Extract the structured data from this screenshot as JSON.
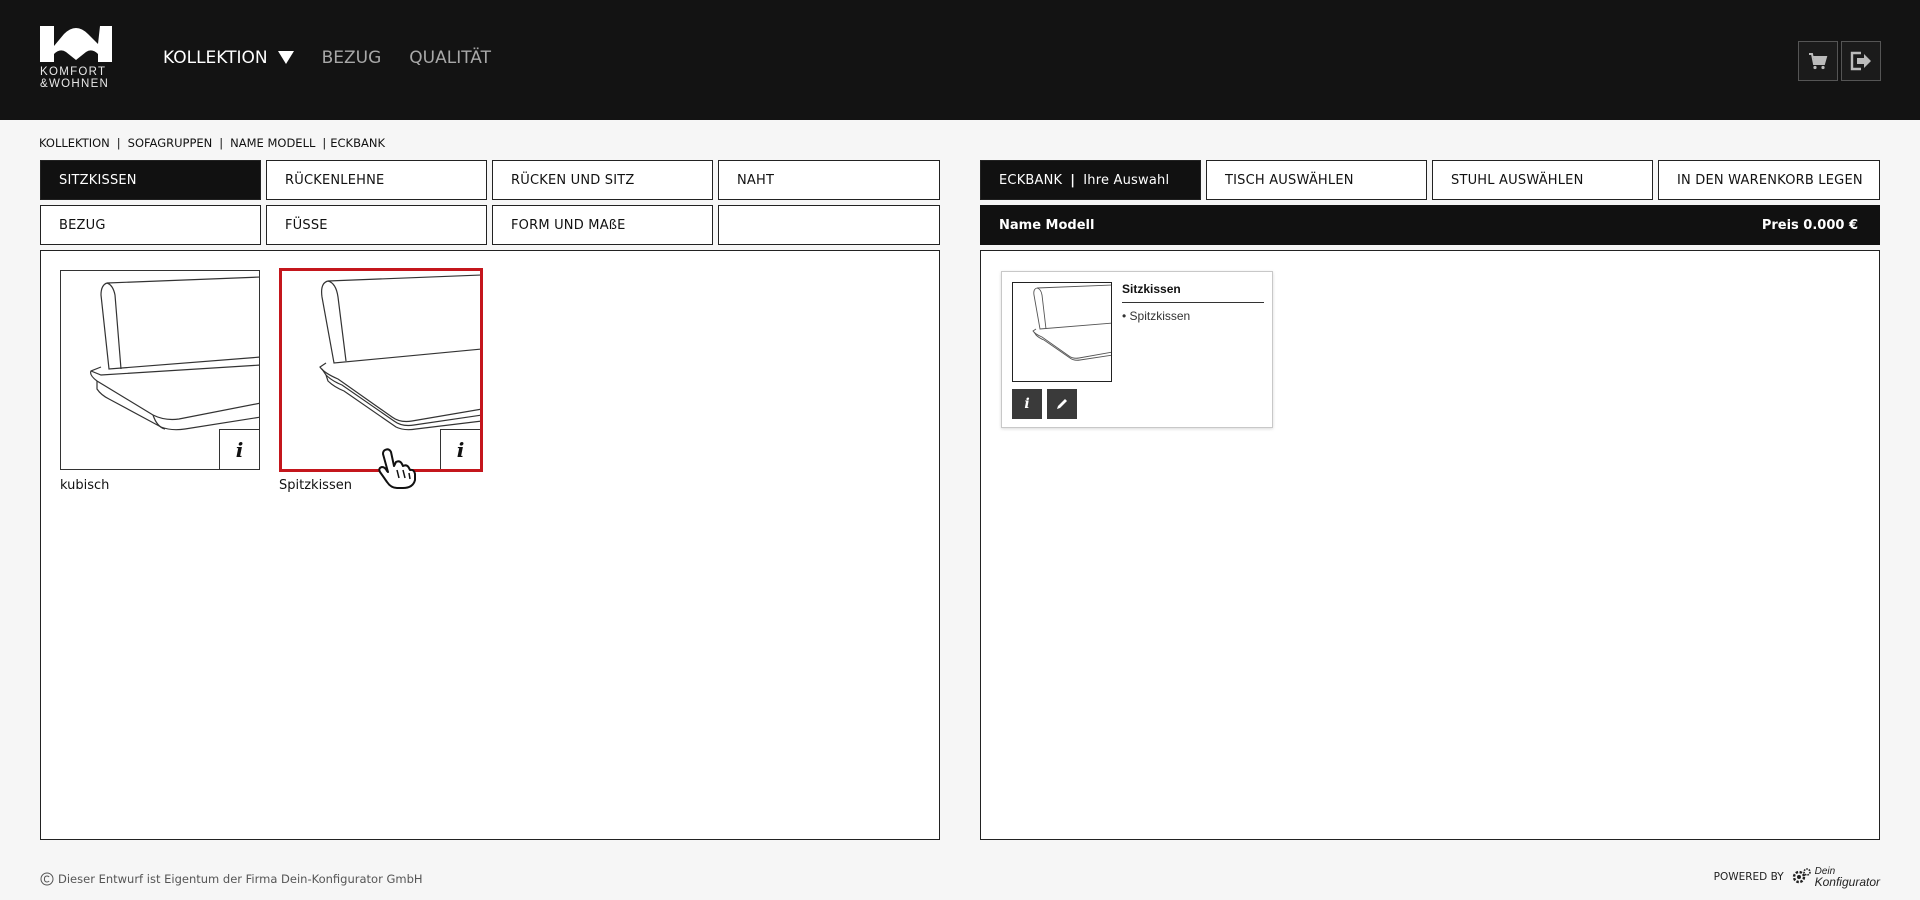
{
  "brand": {
    "line1": "KOMFORT",
    "line2": "&WOHNEN"
  },
  "nav": [
    {
      "label": "KOLLEKTION",
      "active": true
    },
    {
      "label": "BEZUG",
      "active": false
    },
    {
      "label": "QUALITÄT",
      "active": false
    }
  ],
  "header_icons": [
    "cart-icon",
    "logout-icon"
  ],
  "breadcrumb": [
    "KOLLEKTION",
    "SOFAGRUPPEN",
    "NAME MODELL",
    "ECKBANK"
  ],
  "left_tabs": {
    "row1": [
      "SITZKISSEN",
      "RÜCKENLEHNE",
      "RÜCKEN UND SITZ",
      "NAHT"
    ],
    "row2": [
      "BEZUG",
      "FÜSSE",
      "FORM UND MAßE",
      ""
    ],
    "active": "SITZKISSEN"
  },
  "options": [
    {
      "label": "kubisch",
      "selected": false
    },
    {
      "label": "Spitzkissen",
      "selected": true
    }
  ],
  "info_label": "i",
  "right_tabs": {
    "eckbank": "ECKBANK",
    "eckbank_sep": "|",
    "eckbank_sub": "Ihre Auswahl",
    "tisch": "TISCH AUSWÄHLEN",
    "stuhl": "STUHL AUSWÄHLEN",
    "warenkorb": "IN DEN WARENKORB LEGEN"
  },
  "summary": {
    "model_name": "Name Modell",
    "price": "Preis 0.000 €"
  },
  "card": {
    "title": "Sitzkissen",
    "value": "• Spitzkissen",
    "info": "i"
  },
  "footer": {
    "copyright": "Dieser Entwurf ist Eigentum der Firma Dein-Konfigurator GmbH",
    "powered_by": "POWERED BY",
    "brand_line1": "Dein",
    "brand_line2": "Konfigurator"
  },
  "colors": {
    "header_bg": "#131313",
    "selected_border": "#c4161c",
    "active_tab": "#111111"
  }
}
